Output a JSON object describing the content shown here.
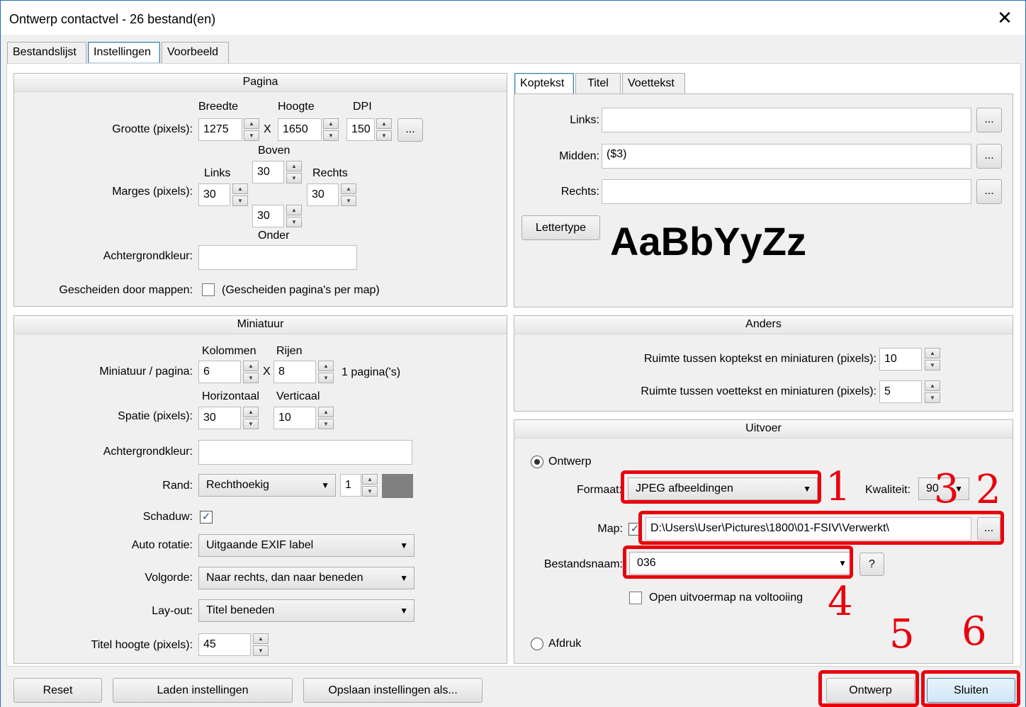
{
  "window": {
    "title": "Ontwerp contactvel - 26 bestand(en)",
    "close_glyph": "✕"
  },
  "tabs": [
    "Bestandslijst",
    "Instellingen",
    "Voorbeeld"
  ],
  "pagina": {
    "header": "Pagina",
    "col_breedte": "Breedte",
    "col_hoogte": "Hoogte",
    "col_dpi": "DPI",
    "grootte_label": "Grootte (pixels):",
    "breedte": "1275",
    "x1": "X",
    "hoogte": "1650",
    "dpi": "150",
    "dots_btn": "...",
    "boven_label": "Boven",
    "links_label": "Links",
    "rechts_label": "Rechts",
    "onder_label": "Onder",
    "marges_label": "Marges (pixels):",
    "marge_links": "30",
    "marge_boven": "30",
    "marge_rechts": "30",
    "marge_onder": "30",
    "achtergrond_label": "Achtergrondkleur:",
    "gescheiden_label": "Gescheiden door mappen:",
    "gescheiden_hint": "(Gescheiden pagina's per map)"
  },
  "kop": {
    "tabs": [
      "Koptekst",
      "Titel",
      "Voettekst"
    ],
    "links_label": "Links:",
    "links_value": "",
    "midden_label": "Midden:",
    "midden_value": "($3)",
    "rechts_label": "Rechts:",
    "rechts_value": "",
    "dots": "...",
    "lettertype_btn": "Lettertype",
    "preview": "AaBbYyZz"
  },
  "miniatuur": {
    "header": "Miniatuur",
    "kolommen_label": "Kolommen",
    "rijen_label": "Rijen",
    "per_pagina_label": "Miniatuur / pagina:",
    "kolommen": "6",
    "x": "X",
    "rijen": "8",
    "paginas": "1 pagina('s)",
    "horizontaal_label": "Horizontaal",
    "verticaal_label": "Verticaal",
    "spatie_label": "Spatie (pixels):",
    "spatie_h": "30",
    "spatie_v": "10",
    "achtergrond_label": "Achtergrondkleur:",
    "rand_label": "Rand:",
    "rand_value": "Rechthoekig",
    "rand_width": "1",
    "rand_color": "#808080",
    "schaduw_label": "Schaduw:",
    "rotatie_label": "Auto rotatie:",
    "rotatie_value": "Uitgaande EXIF label",
    "volgorde_label": "Volgorde:",
    "volgorde_value": "Naar rechts, dan naar beneden",
    "layout_label": "Lay-out:",
    "layout_value": "Titel beneden",
    "titel_hoogte_label": "Titel hoogte (pixels):",
    "titel_hoogte": "45"
  },
  "anders": {
    "header": "Anders",
    "kop_label": "Ruimte tussen koptekst en miniaturen (pixels):",
    "kop_value": "10",
    "voet_label": "Ruimte tussen voettekst en miniaturen (pixels):",
    "voet_value": "5"
  },
  "uitvoer": {
    "header": "Uitvoer",
    "ontwerp_label": "Ontwerp",
    "formaat_label": "Formaat:",
    "formaat_value": "JPEG afbeeldingen",
    "kwaliteit_label": "Kwaliteit:",
    "kwaliteit_value": "90",
    "map_label": "Map:",
    "map_value": "D:\\Users\\User\\Pictures\\1800\\01-FSIV\\Verwerkt\\",
    "dots": "...",
    "bestandsnaam_label": "Bestandsnaam:",
    "bestandsnaam_value": "036",
    "help": "?",
    "open_label": "Open uitvoermap na voltooiing",
    "afdruk_label": "Afdruk"
  },
  "buttons": {
    "reset": "Reset",
    "laden": "Laden instellingen",
    "opslaan": "Opslaan instellingen als...",
    "ontwerp": "Ontwerp",
    "sluiten": "Sluiten"
  },
  "annotations": [
    "1",
    "2",
    "3",
    "4",
    "5",
    "6"
  ],
  "colors": {
    "annotation": "#e8000d",
    "accent": "#3c7fb1"
  }
}
